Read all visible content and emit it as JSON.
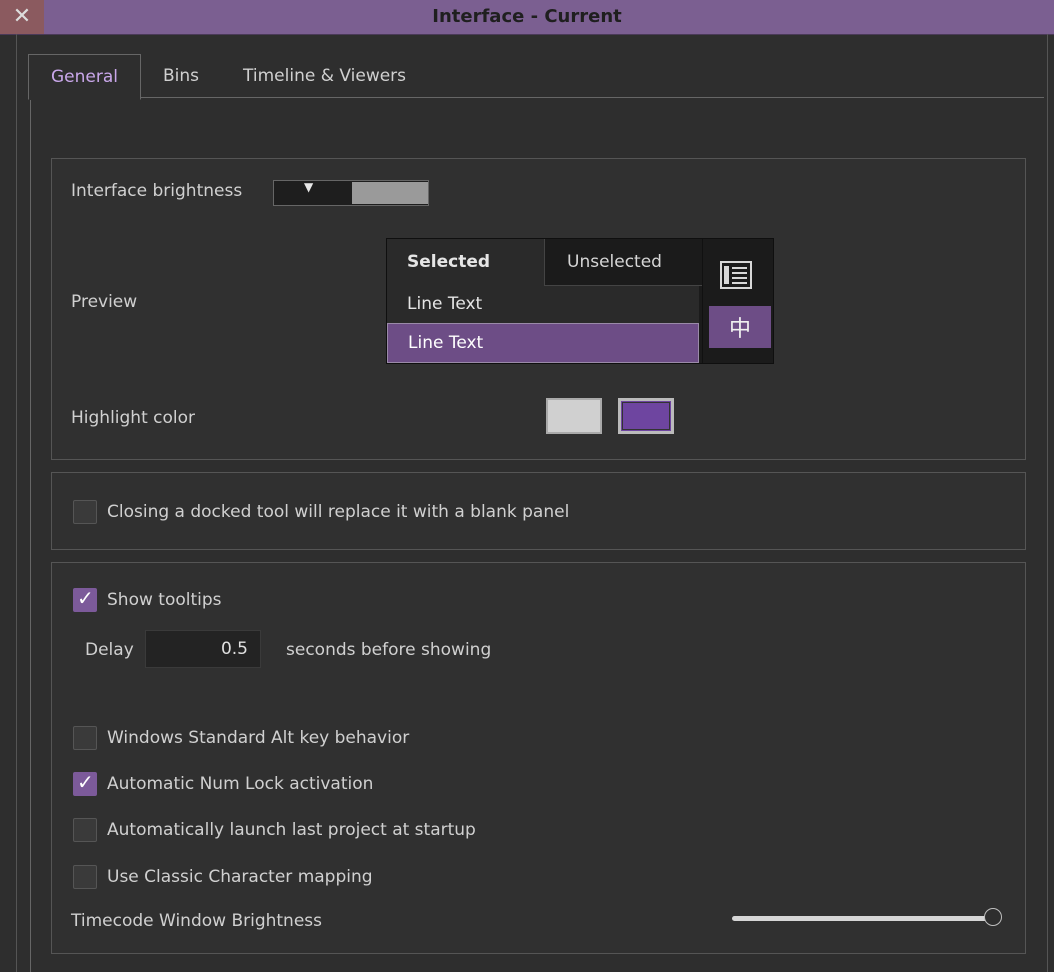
{
  "window": {
    "title": "Interface - Current",
    "close_glyph": "✕"
  },
  "tabs": [
    {
      "label": "General",
      "active": true
    },
    {
      "label": "Bins",
      "active": false
    },
    {
      "label": "Timeline & Viewers",
      "active": false
    }
  ],
  "appearance": {
    "brightness_label": "Interface brightness",
    "brightness_level": 0.5,
    "brightness_marker_glyph": "▼",
    "preview_label": "Preview",
    "preview": {
      "tab_selected": "Selected",
      "tab_unselected": "Unselected",
      "row1": "Line Text",
      "row2": "Line Text",
      "layout_icon_glyph": "中"
    },
    "highlight_label": "Highlight color",
    "highlight_colors": [
      "#d0d0d0",
      "#6e45a0"
    ],
    "accent": "#6d4d86"
  },
  "docked": {
    "checkbox_label": "Closing a docked tool will replace it with a blank panel",
    "checked": false
  },
  "options": {
    "show_tooltips_label": "Show tooltips",
    "show_tooltips_checked": true,
    "delay_label": "Delay",
    "delay_value": "0.5",
    "delay_suffix": "seconds before showing",
    "alt_key_label": "Windows Standard Alt key behavior",
    "alt_key_checked": false,
    "numlock_label": "Automatic Num Lock activation",
    "numlock_checked": true,
    "launch_label": "Automatically launch last project at startup",
    "launch_checked": false,
    "classic_label": "Use Classic Character mapping",
    "classic_checked": false,
    "timecode_label": "Timecode Window Brightness",
    "timecode_level": 1.0
  }
}
